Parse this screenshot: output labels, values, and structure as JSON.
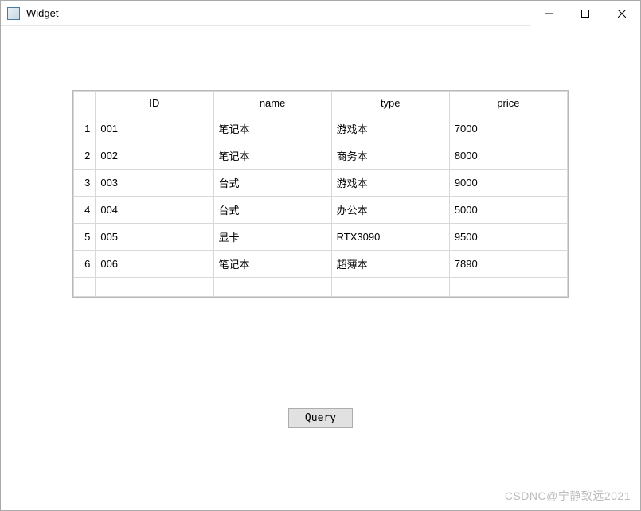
{
  "window": {
    "title": "Widget"
  },
  "table": {
    "headers": {
      "id": "ID",
      "name": "name",
      "type": "type",
      "price": "price"
    },
    "rows": [
      {
        "num": "1",
        "id": "001",
        "name": "笔记本",
        "type": "游戏本",
        "price": "7000"
      },
      {
        "num": "2",
        "id": "002",
        "name": "笔记本",
        "type": "商务本",
        "price": "8000"
      },
      {
        "num": "3",
        "id": "003",
        "name": "台式",
        "type": "游戏本",
        "price": "9000"
      },
      {
        "num": "4",
        "id": "004",
        "name": "台式",
        "type": "办公本",
        "price": "5000"
      },
      {
        "num": "5",
        "id": "005",
        "name": "显卡",
        "type": "RTX3090",
        "price": "9500"
      },
      {
        "num": "6",
        "id": "006",
        "name": "笔记本",
        "type": "超薄本",
        "price": "7890"
      }
    ]
  },
  "buttons": {
    "query": "Query"
  },
  "watermark": "CSDNC@宁静致远2021"
}
